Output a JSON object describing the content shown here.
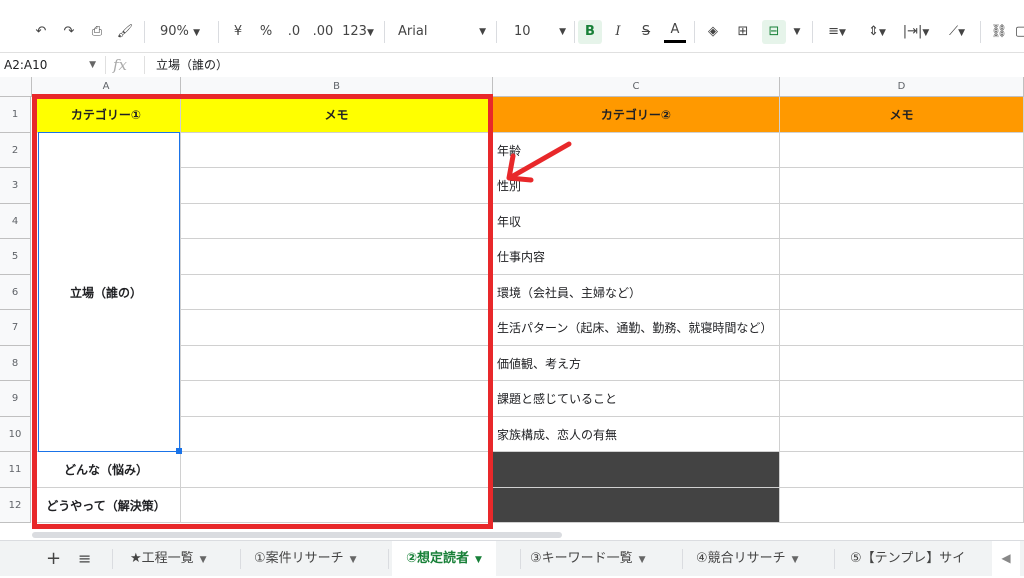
{
  "toolbar": {
    "zoom": "90%",
    "currency": "¥",
    "percent": "%",
    "dec_less": ".0",
    "dec_more": ".00",
    "format_more": "123",
    "font": "Arial",
    "font_size": "10",
    "bold": "B",
    "italic": "I",
    "strike": "S",
    "text_color": "A"
  },
  "formula_bar": {
    "name_box": "A2:A10",
    "fx": "fx",
    "value": "立場（誰の）"
  },
  "columns": [
    "A",
    "B",
    "C",
    "D"
  ],
  "rows": [
    "1",
    "2",
    "3",
    "4",
    "5",
    "6",
    "7",
    "8",
    "9",
    "10",
    "11",
    "12"
  ],
  "headers": {
    "a1": "カテゴリー①",
    "b1": "メモ",
    "c1": "カテゴリー②",
    "d1": "メモ"
  },
  "col_a": {
    "merged": "立場（誰の）",
    "row11": "どんな（悩み）",
    "row12": "どうやって（解決策）"
  },
  "col_c": [
    "年齢",
    "性別",
    "年収",
    "仕事内容",
    "環境（会社員、主婦など）",
    "生活パターン（起床、通勤、勤務、就寝時間など）",
    "価値観、考え方",
    "課題と感じていること",
    "家族構成、恋人の有無"
  ],
  "sheet_tabs": [
    {
      "label": "★工程一覧"
    },
    {
      "label": "①案件リサーチ"
    },
    {
      "label": "②想定読者"
    },
    {
      "label": "③キーワード一覧"
    },
    {
      "label": "④競合リサーチ"
    },
    {
      "label": "⑤【テンプレ】サイ"
    }
  ],
  "colors": {
    "yellow_header": "#ffff00",
    "orange_header": "#ff9900",
    "annotation_red": "#e8282a",
    "dark_fill": "#434343",
    "active_tab": "#188038"
  }
}
